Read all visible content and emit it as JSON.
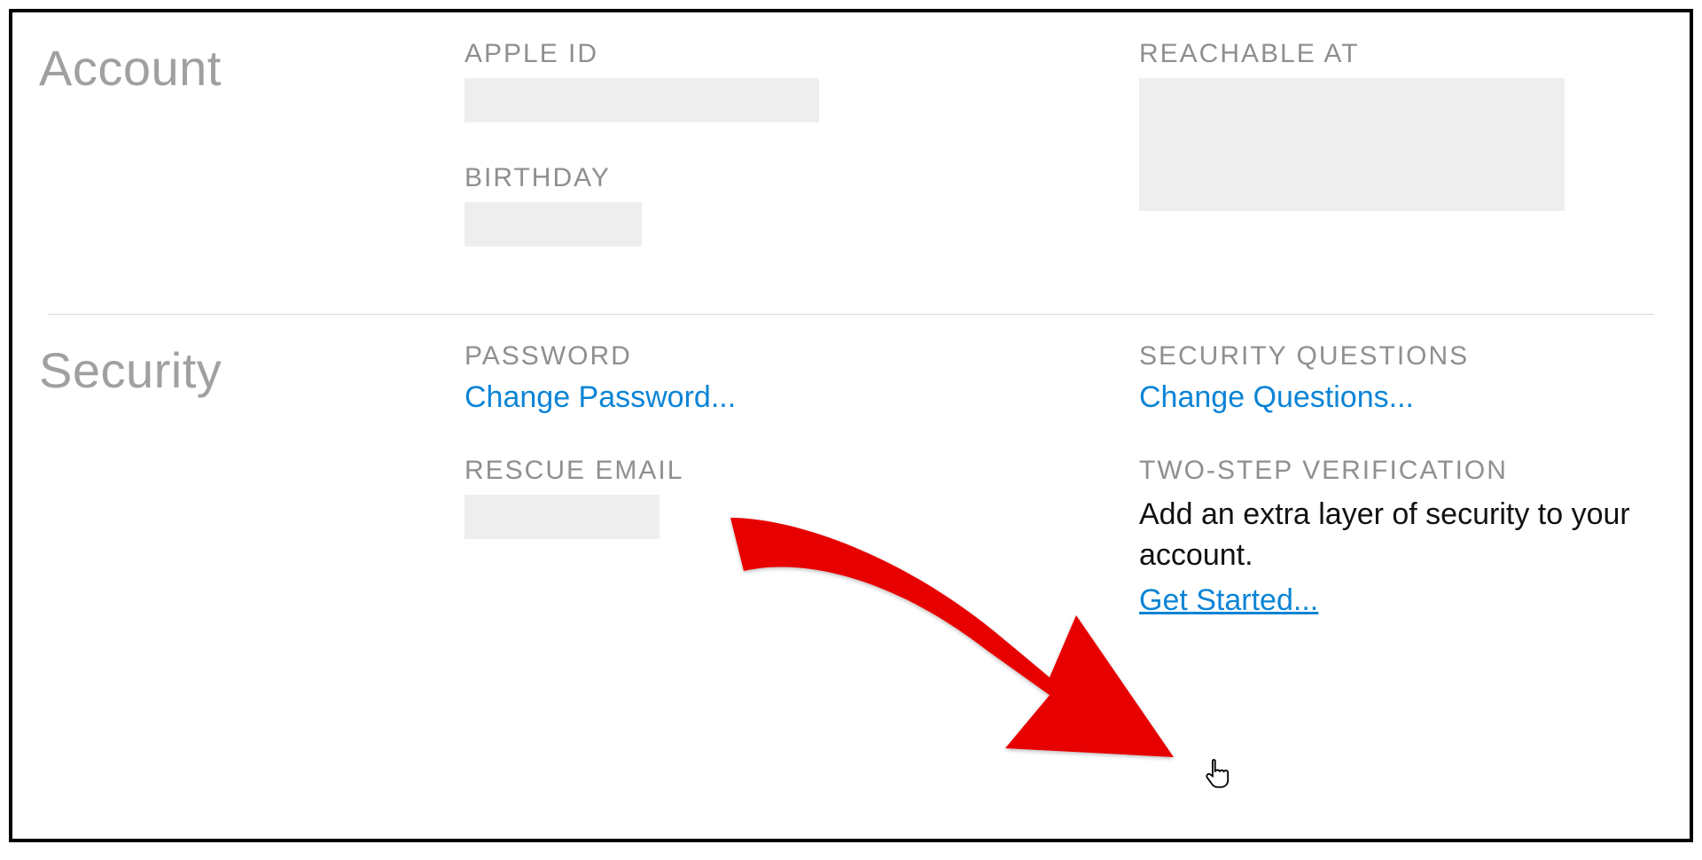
{
  "account": {
    "title": "Account",
    "apple_id_label": "APPLE ID",
    "birthday_label": "BIRTHDAY",
    "reachable_label": "REACHABLE AT"
  },
  "security": {
    "title": "Security",
    "password_label": "PASSWORD",
    "change_password": "Change Password...",
    "rescue_email_label": "RESCUE EMAIL",
    "security_questions_label": "SECURITY QUESTIONS",
    "change_questions": "Change Questions...",
    "two_step_label": "TWO-STEP VERIFICATION",
    "two_step_desc": "Add an extra layer of security to your account.",
    "get_started": "Get Started..."
  }
}
